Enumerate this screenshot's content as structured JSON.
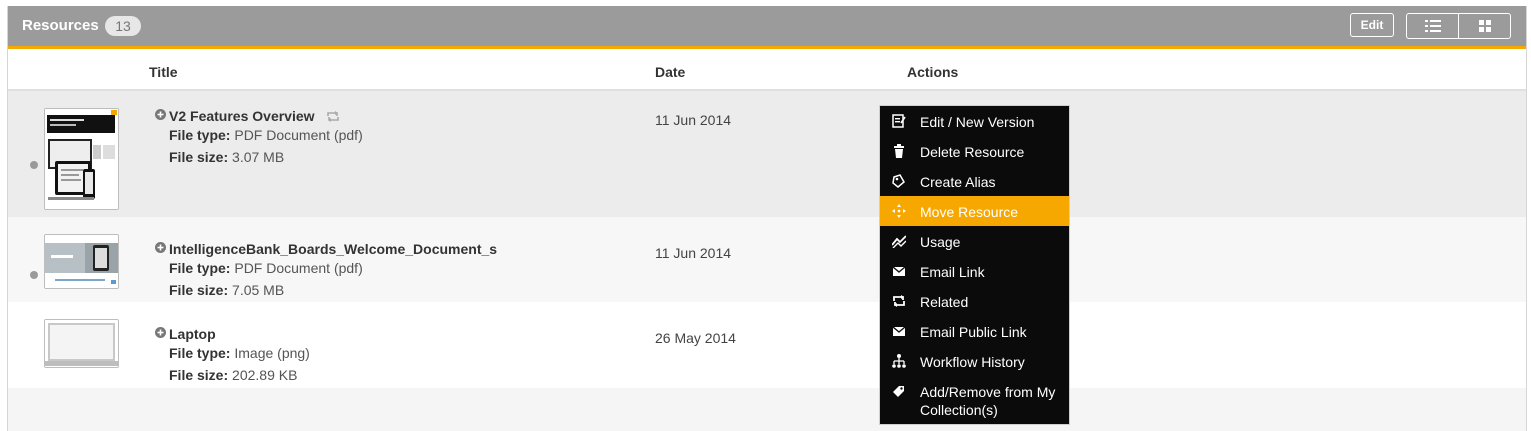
{
  "header": {
    "title": "Resources",
    "count": "13",
    "edit_label": "Edit",
    "view_list_icon": "list-view-icon",
    "view_grid_icon": "grid-view-icon"
  },
  "columns": {
    "title": "Title",
    "date": "Date",
    "actions": "Actions"
  },
  "resources": [
    {
      "title": "V2 Features Overview",
      "file_type_label": "File type:",
      "file_type": "PDF Document (pdf)",
      "file_size_label": "File size:",
      "file_size": "3.07 MB",
      "date": "11 Jun 2014",
      "has_related_icon": true
    },
    {
      "title": "IntelligenceBank_Boards_Welcome_Document_s",
      "file_type_label": "File type:",
      "file_type": "PDF Document (pdf)",
      "file_size_label": "File size:",
      "file_size": "7.05 MB",
      "date": "11 Jun 2014"
    },
    {
      "title": "Laptop",
      "file_type_label": "File type:",
      "file_type": "Image (png)",
      "file_size_label": "File size:",
      "file_size": "202.89 KB",
      "date": "26 May 2014"
    }
  ],
  "actions_menu": {
    "items": [
      {
        "label": "Edit / New Version",
        "icon": "edit-icon"
      },
      {
        "label": "Delete Resource",
        "icon": "trash-icon"
      },
      {
        "label": "Create Alias",
        "icon": "alias-icon"
      },
      {
        "label": "Move Resource",
        "icon": "move-icon",
        "active": true
      },
      {
        "label": "Usage",
        "icon": "usage-chart-icon"
      },
      {
        "label": "Email Link",
        "icon": "envelope-icon"
      },
      {
        "label": "Related",
        "icon": "related-icon"
      },
      {
        "label": "Email Public Link",
        "icon": "envelope-icon"
      },
      {
        "label": "Workflow History",
        "icon": "workflow-icon"
      },
      {
        "label": "Add/Remove from My Collection(s)",
        "icon": "tag-icon"
      }
    ],
    "active_color": "#f7a800"
  },
  "colors": {
    "header_bg": "#9b9b9b",
    "accent": "#f5a800",
    "menu_bg": "#0b0b0b"
  }
}
